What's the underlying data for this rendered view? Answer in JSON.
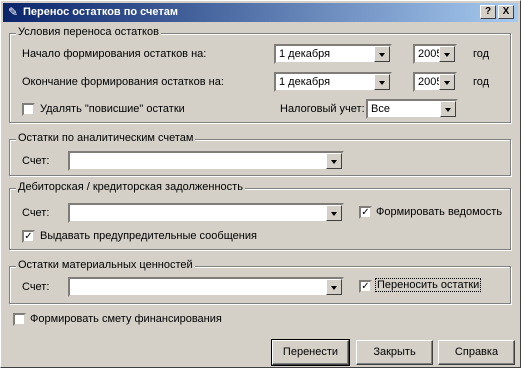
{
  "window": {
    "title": "Перенос остатков по счетам",
    "help_glyph": "?",
    "close_glyph": "X"
  },
  "conditions": {
    "group_title": "Условия переноса остатков",
    "start_label": "Начало формирования остатков на:",
    "start_month": "1 декабря",
    "start_year": "2005",
    "start_year_unit": "год",
    "end_label": "Окончание формирования остатков на:",
    "end_month": "1 декабря",
    "end_year": "2005",
    "end_year_unit": "год",
    "delete_hanging_label": "Удалять \"повисшие\" остатки",
    "delete_hanging_checked": false,
    "tax_label": "Налоговый учет:",
    "tax_value": "Все"
  },
  "analytic": {
    "group_title": "Остатки по аналитическим счетам",
    "account_label": "Счет:",
    "account_value": ""
  },
  "debt": {
    "group_title": "Дебиторская / кредиторская задолженность",
    "account_label": "Счет:",
    "account_value": "",
    "form_statement_label": "Формировать ведомость",
    "form_statement_checked": true,
    "warnings_label": "Выдавать предупредительные сообщения",
    "warnings_checked": true
  },
  "material": {
    "group_title": "Остатки материальных ценностей",
    "account_label": "Счет:",
    "account_value": "",
    "transfer_label": "Переносить остатки",
    "transfer_checked": true
  },
  "budget": {
    "label": "Формировать смету финансирования",
    "checked": false
  },
  "buttons": {
    "transfer": "Перенести",
    "close": "Закрыть",
    "help": "Справка"
  },
  "check_glyph": "✓"
}
